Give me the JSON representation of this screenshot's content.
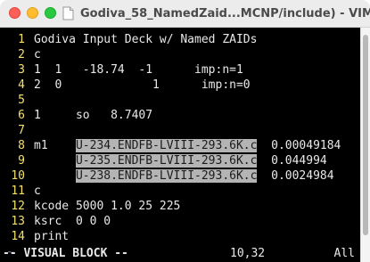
{
  "window": {
    "title": "Godiva_58_NamedZaid...MCNP/include) - VIM"
  },
  "editor": {
    "lines": [
      {
        "num": "1",
        "text": "Godiva Input Deck w/ Named ZAIDs"
      },
      {
        "num": "2",
        "text": "c"
      },
      {
        "num": "3",
        "text": "1  1   -18.74  -1      imp:n=1"
      },
      {
        "num": "4",
        "text": "2  0             1      imp:n=0"
      },
      {
        "num": "5",
        "text": ""
      },
      {
        "num": "6",
        "text": "1     so   8.7407"
      },
      {
        "num": "7",
        "text": ""
      },
      {
        "num": "8",
        "pre": "m1    ",
        "sel": "U-234.ENDFB-LVIII-293.6K.c",
        "post": "  0.00049184"
      },
      {
        "num": "9",
        "pre": "      ",
        "sel": "U-235.ENDFB-LVIII-293.6K.c",
        "post": "  0.044994"
      },
      {
        "num": "10",
        "pre": "      ",
        "sel": "U-238.ENDFB-LVIII-293.6K.c",
        "post": "  0.0024984"
      },
      {
        "num": "11",
        "text": "c"
      },
      {
        "num": "12",
        "text": "kcode 5000 1.0 25 225"
      },
      {
        "num": "13",
        "text": "ksrc  0 0 0"
      },
      {
        "num": "14",
        "text": "print"
      }
    ],
    "tilde": "~"
  },
  "status": {
    "mode": "-- VISUAL BLOCK --",
    "position": "10,32",
    "scroll": "All"
  },
  "colors": {
    "background": "#000000",
    "line_number": "#f3e06b",
    "selection": "#b4b4b4",
    "text": "#e8e8e8"
  }
}
